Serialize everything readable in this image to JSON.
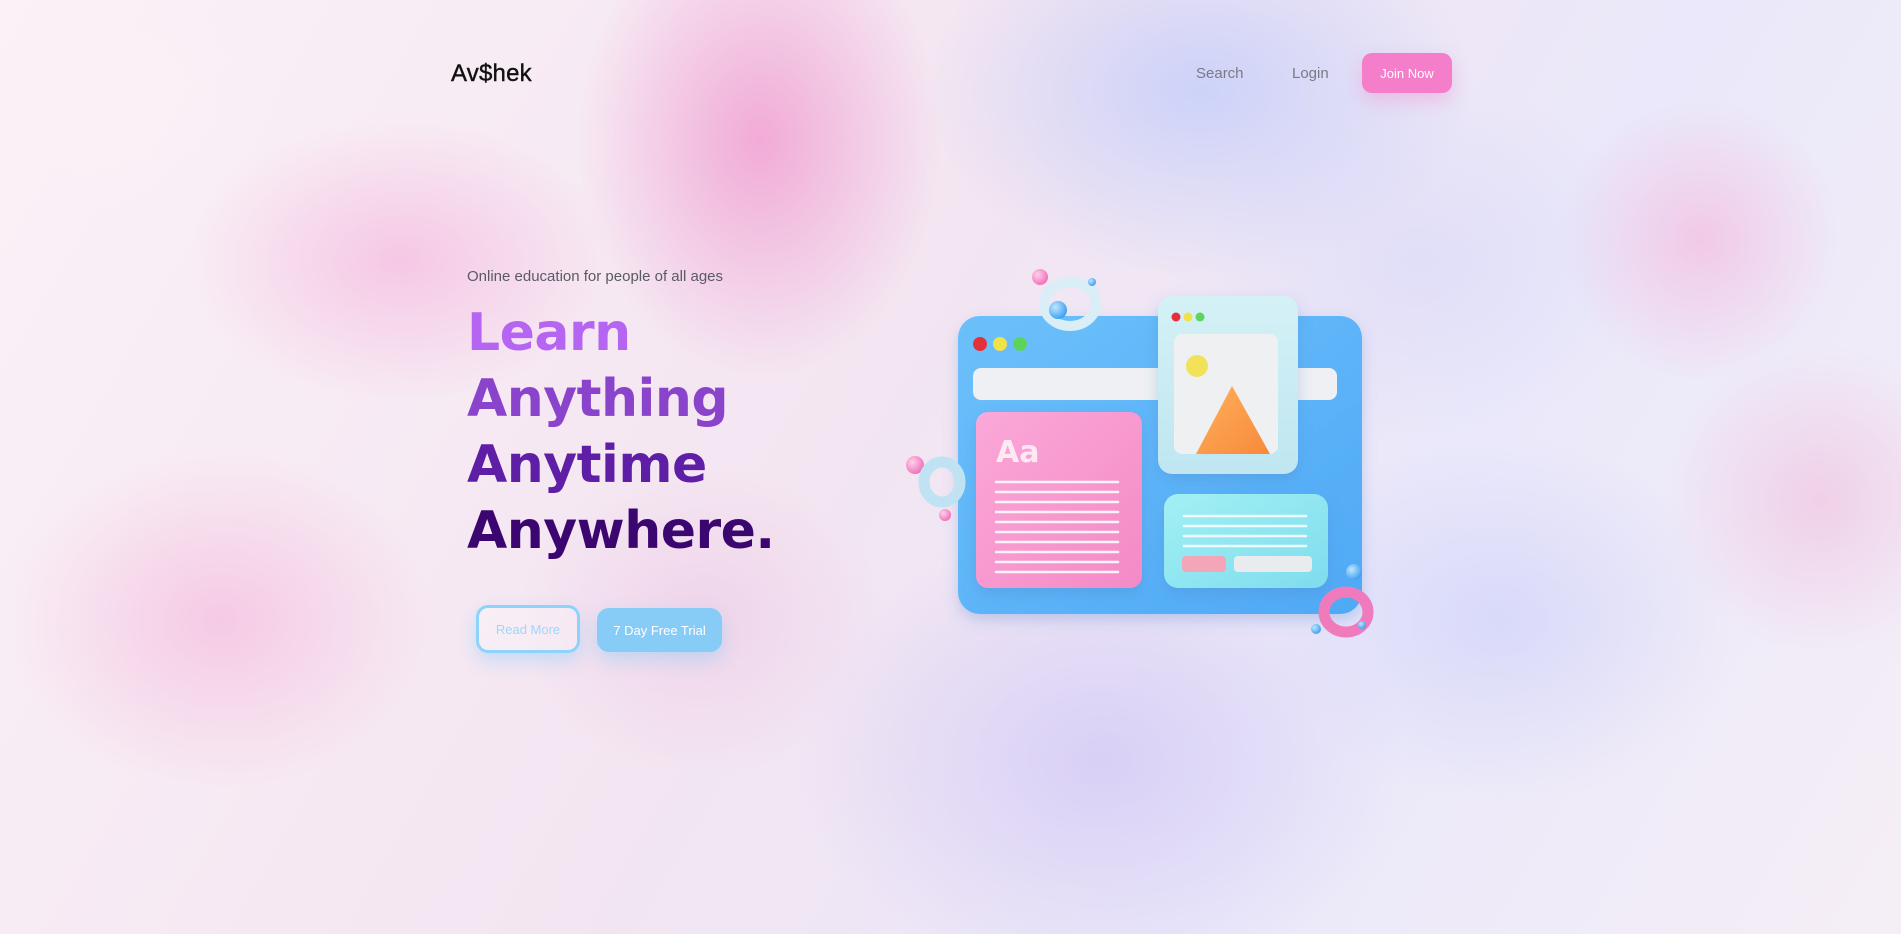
{
  "nav": {
    "logo": "Av$hek",
    "links": [
      "Search",
      "Login"
    ],
    "cta": "Join Now"
  },
  "hero": {
    "subtitle": "Online education for people of all ages",
    "headline": [
      "Learn",
      "Anything",
      "Anytime",
      "Anywhere."
    ],
    "buttons": {
      "secondary": "Read More",
      "primary": "7 Day Free Trial"
    }
  },
  "illustration": {
    "card_text": "Aa"
  },
  "colors": {
    "accent_pink": "#f47ec9",
    "accent_blue": "#86ccf7",
    "headline_1": "#b565f2",
    "headline_2": "#8a44cc",
    "headline_3": "#5e1fa6",
    "headline_4": "#3b0670"
  }
}
